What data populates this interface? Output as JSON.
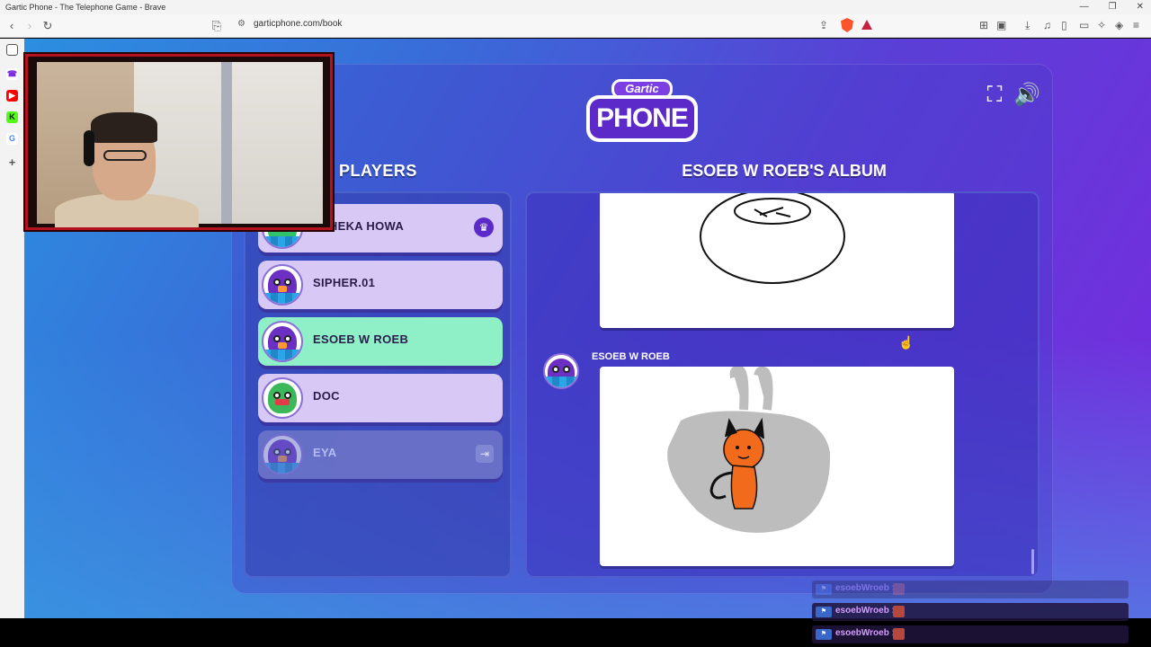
{
  "browser": {
    "window_title": "Gartic Phone - The Telephone Game - Brave",
    "url": "garticphone.com/book",
    "window_controls": [
      "—",
      "❐",
      "✕"
    ]
  },
  "sidebar": {
    "icons": [
      "panel-icon",
      "gartic-icon",
      "youtube-icon",
      "kick-icon",
      "google-icon",
      "add-icon"
    ]
  },
  "game": {
    "logo_top": "Gartic",
    "logo_main": "PHONE",
    "players_title": "PLAYERS",
    "album_title": "ESOEB W ROEB'S ALBUM",
    "players": [
      {
        "name": "ALHEKA HOWA",
        "state": "host"
      },
      {
        "name": "SIPHER.01",
        "state": "normal"
      },
      {
        "name": "ESOEB W ROEB",
        "state": "active"
      },
      {
        "name": "DOC",
        "state": "normal"
      },
      {
        "name": "EYA",
        "state": "away"
      }
    ],
    "album": {
      "entry_author": "ESOEB W ROEB"
    }
  },
  "chat": {
    "messages": [
      {
        "user": "esoebWroeb :",
        "faded": true
      },
      {
        "user": "esoebWroeb :",
        "faded": false
      },
      {
        "user": "esoebWroeb :",
        "faded": false
      }
    ]
  },
  "colors": {
    "active_player": "#8ff0c8",
    "player": "#d7c8f5",
    "webcam_border": "#b4121e"
  }
}
